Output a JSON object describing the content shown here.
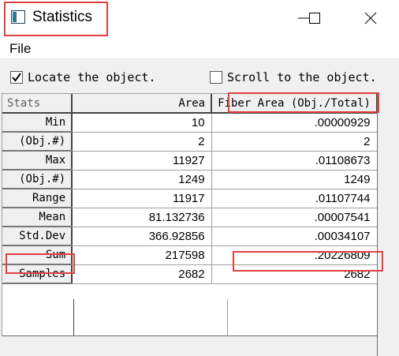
{
  "window": {
    "title": "Statistics",
    "icon": "app-window-icon",
    "controls": {
      "minimize": "minimize-icon",
      "maximize": "maximize-icon",
      "close": "close-icon"
    }
  },
  "menu": {
    "file": "File"
  },
  "options": {
    "locate_label": "Locate the object.",
    "locate_checked": true,
    "scroll_label": "Scroll to the object.",
    "scroll_checked": false
  },
  "grid": {
    "headers": [
      "Stats",
      "Area",
      "Fiber Area (Obj./Total)"
    ],
    "rows": [
      {
        "label": "Min",
        "area": "10",
        "ratio": ".00000929"
      },
      {
        "label": "(Obj.#)",
        "area": "2",
        "ratio": "2"
      },
      {
        "label": "Max",
        "area": "11927",
        "ratio": ".01108673"
      },
      {
        "label": "(Obj.#)",
        "area": "1249",
        "ratio": "1249"
      },
      {
        "label": "Range",
        "area": "11917",
        "ratio": ".01107744"
      },
      {
        "label": "Mean",
        "area": "81.132736",
        "ratio": ".00007541"
      },
      {
        "label": "Std.Dev",
        "area": "366.92856",
        "ratio": ".00034107"
      },
      {
        "label": "Sum",
        "area": "217598",
        "ratio": ".20226809"
      },
      {
        "label": "Samples",
        "area": "2682",
        "ratio": "2682"
      }
    ]
  },
  "colors": {
    "highlight": "#e04040",
    "panel": "#f0f0f0"
  }
}
